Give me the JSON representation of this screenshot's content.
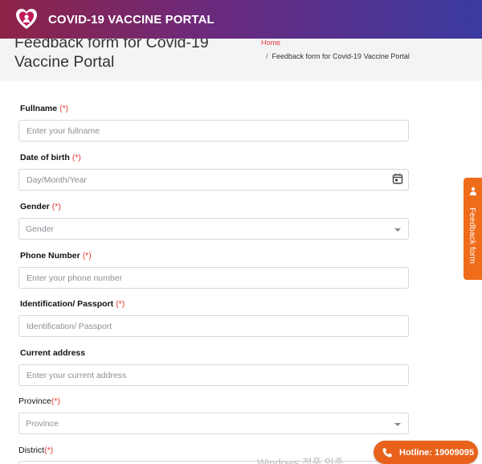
{
  "app": {
    "title": "COVID-19 VACCINE PORTAL"
  },
  "page": {
    "title": "Feedback form for Covid-19 Vaccine Portal"
  },
  "breadcrumb": {
    "home": "Home",
    "separator": "/",
    "current": "Feedback form for Covid-19 Vaccine Portal"
  },
  "form": {
    "required_mark": "(*)",
    "fullname": {
      "label": "Fullname",
      "placeholder": "Enter your fullname"
    },
    "dob": {
      "label": "Date of birth",
      "placeholder": "Day/Month/Year"
    },
    "gender": {
      "label": "Gender",
      "value": "Gender"
    },
    "phone": {
      "label": "Phone Number",
      "placeholder": "Enter your phone number"
    },
    "identification": {
      "label": "Identification/ Passport",
      "placeholder": "Identification/ Passport"
    },
    "address": {
      "label": "Current address",
      "placeholder": "Enter your current address"
    },
    "province": {
      "label": "Province",
      "value": "Province"
    },
    "district": {
      "label": "District"
    }
  },
  "side_tab": {
    "label": "Feedback form"
  },
  "hotline": {
    "label": "Hotline: 19009095"
  },
  "watermark": {
    "text": "Windows 정품 인증"
  },
  "colors": {
    "header_start": "#8e2347",
    "header_end": "#3a3aa0",
    "accent_orange": "#ef6c1a",
    "required_red": "#e53935",
    "breadcrumb_link": "#e03a3a"
  },
  "icons": {
    "logo": "heart-shield-logo-icon",
    "calendar": "calendar-icon",
    "dropdown": "caret-down-icon",
    "feedback": "feedback-person-icon",
    "hotline": "phone-icon"
  }
}
